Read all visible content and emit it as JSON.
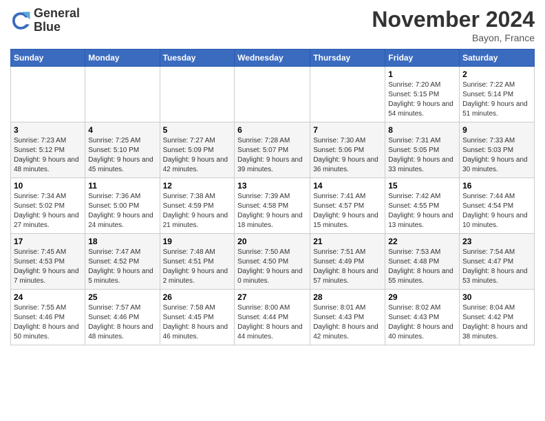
{
  "header": {
    "logo_line1": "General",
    "logo_line2": "Blue",
    "month": "November 2024",
    "location": "Bayon, France"
  },
  "weekdays": [
    "Sunday",
    "Monday",
    "Tuesday",
    "Wednesday",
    "Thursday",
    "Friday",
    "Saturday"
  ],
  "weeks": [
    [
      {
        "day": "",
        "info": ""
      },
      {
        "day": "",
        "info": ""
      },
      {
        "day": "",
        "info": ""
      },
      {
        "day": "",
        "info": ""
      },
      {
        "day": "",
        "info": ""
      },
      {
        "day": "1",
        "info": "Sunrise: 7:20 AM\nSunset: 5:15 PM\nDaylight: 9 hours and 54 minutes."
      },
      {
        "day": "2",
        "info": "Sunrise: 7:22 AM\nSunset: 5:14 PM\nDaylight: 9 hours and 51 minutes."
      }
    ],
    [
      {
        "day": "3",
        "info": "Sunrise: 7:23 AM\nSunset: 5:12 PM\nDaylight: 9 hours and 48 minutes."
      },
      {
        "day": "4",
        "info": "Sunrise: 7:25 AM\nSunset: 5:10 PM\nDaylight: 9 hours and 45 minutes."
      },
      {
        "day": "5",
        "info": "Sunrise: 7:27 AM\nSunset: 5:09 PM\nDaylight: 9 hours and 42 minutes."
      },
      {
        "day": "6",
        "info": "Sunrise: 7:28 AM\nSunset: 5:07 PM\nDaylight: 9 hours and 39 minutes."
      },
      {
        "day": "7",
        "info": "Sunrise: 7:30 AM\nSunset: 5:06 PM\nDaylight: 9 hours and 36 minutes."
      },
      {
        "day": "8",
        "info": "Sunrise: 7:31 AM\nSunset: 5:05 PM\nDaylight: 9 hours and 33 minutes."
      },
      {
        "day": "9",
        "info": "Sunrise: 7:33 AM\nSunset: 5:03 PM\nDaylight: 9 hours and 30 minutes."
      }
    ],
    [
      {
        "day": "10",
        "info": "Sunrise: 7:34 AM\nSunset: 5:02 PM\nDaylight: 9 hours and 27 minutes."
      },
      {
        "day": "11",
        "info": "Sunrise: 7:36 AM\nSunset: 5:00 PM\nDaylight: 9 hours and 24 minutes."
      },
      {
        "day": "12",
        "info": "Sunrise: 7:38 AM\nSunset: 4:59 PM\nDaylight: 9 hours and 21 minutes."
      },
      {
        "day": "13",
        "info": "Sunrise: 7:39 AM\nSunset: 4:58 PM\nDaylight: 9 hours and 18 minutes."
      },
      {
        "day": "14",
        "info": "Sunrise: 7:41 AM\nSunset: 4:57 PM\nDaylight: 9 hours and 15 minutes."
      },
      {
        "day": "15",
        "info": "Sunrise: 7:42 AM\nSunset: 4:55 PM\nDaylight: 9 hours and 13 minutes."
      },
      {
        "day": "16",
        "info": "Sunrise: 7:44 AM\nSunset: 4:54 PM\nDaylight: 9 hours and 10 minutes."
      }
    ],
    [
      {
        "day": "17",
        "info": "Sunrise: 7:45 AM\nSunset: 4:53 PM\nDaylight: 9 hours and 7 minutes."
      },
      {
        "day": "18",
        "info": "Sunrise: 7:47 AM\nSunset: 4:52 PM\nDaylight: 9 hours and 5 minutes."
      },
      {
        "day": "19",
        "info": "Sunrise: 7:48 AM\nSunset: 4:51 PM\nDaylight: 9 hours and 2 minutes."
      },
      {
        "day": "20",
        "info": "Sunrise: 7:50 AM\nSunset: 4:50 PM\nDaylight: 9 hours and 0 minutes."
      },
      {
        "day": "21",
        "info": "Sunrise: 7:51 AM\nSunset: 4:49 PM\nDaylight: 8 hours and 57 minutes."
      },
      {
        "day": "22",
        "info": "Sunrise: 7:53 AM\nSunset: 4:48 PM\nDaylight: 8 hours and 55 minutes."
      },
      {
        "day": "23",
        "info": "Sunrise: 7:54 AM\nSunset: 4:47 PM\nDaylight: 8 hours and 53 minutes."
      }
    ],
    [
      {
        "day": "24",
        "info": "Sunrise: 7:55 AM\nSunset: 4:46 PM\nDaylight: 8 hours and 50 minutes."
      },
      {
        "day": "25",
        "info": "Sunrise: 7:57 AM\nSunset: 4:46 PM\nDaylight: 8 hours and 48 minutes."
      },
      {
        "day": "26",
        "info": "Sunrise: 7:58 AM\nSunset: 4:45 PM\nDaylight: 8 hours and 46 minutes."
      },
      {
        "day": "27",
        "info": "Sunrise: 8:00 AM\nSunset: 4:44 PM\nDaylight: 8 hours and 44 minutes."
      },
      {
        "day": "28",
        "info": "Sunrise: 8:01 AM\nSunset: 4:43 PM\nDaylight: 8 hours and 42 minutes."
      },
      {
        "day": "29",
        "info": "Sunrise: 8:02 AM\nSunset: 4:43 PM\nDaylight: 8 hours and 40 minutes."
      },
      {
        "day": "30",
        "info": "Sunrise: 8:04 AM\nSunset: 4:42 PM\nDaylight: 8 hours and 38 minutes."
      }
    ]
  ]
}
